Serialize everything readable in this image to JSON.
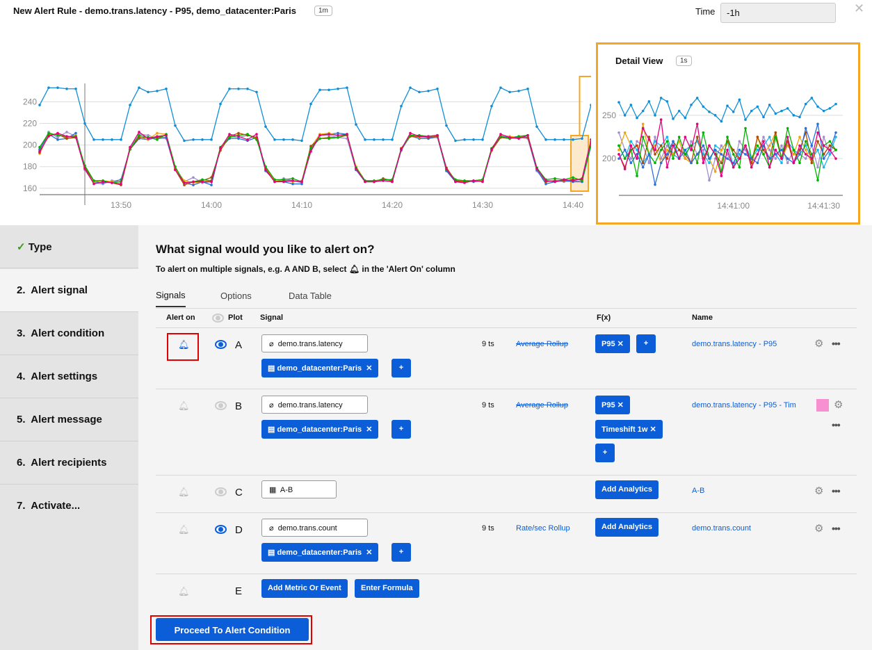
{
  "header": {
    "title": "New Alert Rule - demo.trans.latency - P95, demo_datacenter:Paris",
    "resolution": "1m",
    "time_label": "Time",
    "time_value": "-1h",
    "close_icon": "close-icon"
  },
  "chart_data": [
    {
      "type": "line",
      "title": "",
      "ylim": [
        156,
        257
      ],
      "yticks": [
        "160",
        "180",
        "200",
        "220",
        "240"
      ],
      "xticks": [
        "13:50",
        "14:00",
        "14:10",
        "14:20",
        "14:30",
        "14:40"
      ],
      "grid": true,
      "cursor_time": "13:46",
      "highlight_range": [
        "14:39",
        "14:42"
      ],
      "x": [
        "13:41",
        "13:42",
        "13:43",
        "13:44",
        "13:45",
        "13:46",
        "13:47",
        "13:48",
        "13:49",
        "13:50",
        "13:51",
        "13:52",
        "13:53",
        "13:54",
        "13:55",
        "13:56",
        "13:57",
        "13:58",
        "13:59",
        "14:00",
        "14:01",
        "14:02",
        "14:03",
        "14:04",
        "14:05",
        "14:06",
        "14:07",
        "14:08",
        "14:09",
        "14:10",
        "14:11",
        "14:12",
        "14:13",
        "14:14",
        "14:15",
        "14:16",
        "14:17",
        "14:18",
        "14:19",
        "14:20",
        "14:21",
        "14:22",
        "14:23",
        "14:24",
        "14:25",
        "14:26",
        "14:27",
        "14:28",
        "14:29",
        "14:30",
        "14:31",
        "14:32",
        "14:33",
        "14:34",
        "14:35",
        "14:36",
        "14:37",
        "14:38",
        "14:39",
        "14:40",
        "14:41",
        "14:42"
      ],
      "series": [
        {
          "color": "#0d8ed8",
          "values": [
            237,
            253,
            253,
            252,
            252,
            220,
            205,
            205,
            205,
            205,
            237,
            253,
            249,
            250,
            252,
            218,
            204,
            205,
            205,
            205,
            238,
            252,
            252,
            252,
            249,
            217,
            205,
            205,
            205,
            204,
            238,
            251,
            251,
            252,
            253,
            219,
            205,
            205,
            205,
            205,
            236,
            253,
            249,
            250,
            252,
            218,
            204,
            205,
            205,
            205,
            236,
            253,
            249,
            250,
            252,
            217,
            205,
            205,
            205,
            205,
            206,
            237
          ]
        },
        {
          "color": "#a18fcf",
          "values": [
            195,
            212,
            207,
            212,
            208,
            177,
            165,
            164,
            167,
            166,
            197,
            210,
            209,
            206,
            206,
            177,
            166,
            170,
            165,
            166,
            196,
            208,
            207,
            209,
            207,
            177,
            166,
            169,
            167,
            165,
            196,
            209,
            209,
            207,
            206,
            177,
            167,
            167,
            167,
            167,
            196,
            208,
            206,
            206,
            207,
            177,
            166,
            166,
            167,
            167,
            195,
            207,
            206,
            207,
            206,
            176,
            166,
            167,
            166,
            167,
            166,
            199
          ]
        },
        {
          "color": "#2a6fdb",
          "values": [
            196,
            210,
            205,
            206,
            211,
            179,
            166,
            165,
            166,
            168,
            196,
            206,
            205,
            207,
            207,
            178,
            165,
            163,
            166,
            163,
            197,
            206,
            206,
            204,
            207,
            176,
            167,
            166,
            164,
            164,
            196,
            210,
            210,
            211,
            210,
            177,
            166,
            166,
            167,
            166,
            195,
            209,
            206,
            206,
            208,
            176,
            166,
            167,
            166,
            167,
            196,
            208,
            207,
            208,
            207,
            177,
            164,
            166,
            167,
            166,
            166,
            200
          ]
        },
        {
          "color": "#f0a30a",
          "values": [
            192,
            210,
            210,
            207,
            209,
            180,
            166,
            167,
            166,
            166,
            196,
            208,
            205,
            211,
            210,
            178,
            167,
            165,
            166,
            167,
            196,
            208,
            209,
            210,
            206,
            179,
            167,
            167,
            166,
            167,
            198,
            210,
            211,
            209,
            209,
            180,
            167,
            167,
            167,
            167,
            196,
            209,
            207,
            208,
            209,
            178,
            167,
            167,
            167,
            167,
            197,
            209,
            208,
            207,
            209,
            179,
            167,
            167,
            167,
            168,
            168,
            202
          ]
        },
        {
          "color": "#b04a00",
          "values": [
            193,
            209,
            210,
            206,
            207,
            179,
            167,
            167,
            165,
            163,
            196,
            207,
            207,
            207,
            209,
            177,
            163,
            166,
            167,
            170,
            195,
            208,
            211,
            209,
            207,
            178,
            166,
            167,
            167,
            166,
            199,
            206,
            207,
            207,
            209,
            179,
            166,
            166,
            169,
            167,
            197,
            208,
            208,
            207,
            208,
            179,
            167,
            166,
            167,
            168,
            195,
            207,
            206,
            207,
            207,
            179,
            166,
            167,
            167,
            168,
            168,
            203
          ]
        },
        {
          "color": "#00b200",
          "values": [
            198,
            211,
            209,
            208,
            208,
            181,
            167,
            167,
            165,
            166,
            196,
            209,
            207,
            205,
            210,
            180,
            165,
            166,
            168,
            167,
            198,
            207,
            209,
            210,
            205,
            180,
            168,
            168,
            169,
            166,
            197,
            206,
            206,
            207,
            210,
            179,
            167,
            167,
            168,
            168,
            196,
            209,
            209,
            208,
            209,
            177,
            168,
            167,
            167,
            168,
            197,
            208,
            206,
            208,
            209,
            179,
            168,
            169,
            168,
            170,
            167,
            201
          ]
        },
        {
          "color": "#e5007e",
          "values": [
            194,
            208,
            211,
            208,
            207,
            178,
            164,
            166,
            165,
            164,
            198,
            212,
            206,
            208,
            209,
            177,
            165,
            166,
            166,
            166,
            197,
            210,
            208,
            205,
            210,
            177,
            166,
            166,
            167,
            166,
            194,
            209,
            210,
            209,
            210,
            178,
            166,
            166,
            167,
            166,
            196,
            211,
            208,
            208,
            209,
            178,
            166,
            165,
            167,
            166,
            196,
            210,
            207,
            206,
            209,
            178,
            167,
            166,
            168,
            167,
            169,
            205
          ]
        }
      ]
    },
    {
      "type": "line",
      "title": "Detail View",
      "resolution": "1s",
      "ylim": [
        160,
        286
      ],
      "yticks": [
        "200",
        "250"
      ],
      "xticks": [
        "14:41:00",
        "14:41:30"
      ],
      "grid": true,
      "x": [
        "14:40:22",
        "14:40:24",
        "14:40:26",
        "14:40:28",
        "14:40:30",
        "14:40:32",
        "14:40:34",
        "14:40:36",
        "14:40:38",
        "14:40:40",
        "14:40:42",
        "14:40:44",
        "14:40:46",
        "14:40:48",
        "14:40:50",
        "14:40:52",
        "14:40:54",
        "14:40:56",
        "14:40:58",
        "14:41:00",
        "14:41:02",
        "14:41:04",
        "14:41:06",
        "14:41:08",
        "14:41:10",
        "14:41:12",
        "14:41:14",
        "14:41:16",
        "14:41:18",
        "14:41:20",
        "14:41:22",
        "14:41:24",
        "14:41:26",
        "14:41:28",
        "14:41:30",
        "14:41:32",
        "14:41:34"
      ],
      "series": [
        {
          "color": "#0d8ed8",
          "values": [
            265,
            250,
            262,
            247,
            255,
            266,
            250,
            270,
            266,
            246,
            255,
            247,
            262,
            270,
            260,
            254,
            250,
            243,
            261,
            254,
            268,
            245,
            255,
            260,
            248,
            262,
            252,
            255,
            258,
            250,
            248,
            263,
            270,
            260,
            255,
            258,
            263
          ]
        },
        {
          "color": "#a18fcf",
          "values": [
            230,
            210,
            200,
            220,
            215,
            195,
            225,
            200,
            215,
            205,
            210,
            200,
            220,
            205,
            210,
            175,
            200,
            215,
            205,
            190,
            220,
            210,
            195,
            205,
            225,
            210,
            200,
            215,
            195,
            210,
            205,
            200,
            215,
            190,
            225,
            205,
            210
          ]
        },
        {
          "color": "#1ab4f0",
          "values": [
            215,
            200,
            220,
            210,
            195,
            205,
            220,
            215,
            225,
            205,
            200,
            210,
            215,
            220,
            205,
            195,
            215,
            210,
            220,
            190,
            205,
            215,
            200,
            210,
            215,
            225,
            205,
            195,
            220,
            210,
            205,
            215,
            200,
            210,
            190,
            205,
            225
          ]
        },
        {
          "color": "#f0a30a",
          "values": [
            210,
            230,
            215,
            200,
            240,
            205,
            215,
            195,
            210,
            205,
            220,
            200,
            195,
            205,
            215,
            200,
            185,
            210,
            220,
            205,
            200,
            215,
            190,
            225,
            205,
            215,
            230,
            200,
            215,
            205,
            225,
            210,
            195,
            220,
            205,
            215,
            210
          ]
        },
        {
          "color": "#b04a00",
          "values": [
            205,
            190,
            210,
            215,
            195,
            225,
            205,
            215,
            200,
            220,
            210,
            205,
            195,
            225,
            200,
            215,
            205,
            195,
            220,
            210,
            200,
            215,
            195,
            225,
            210,
            200,
            230,
            200,
            220,
            195,
            210,
            230,
            195,
            220,
            205,
            215,
            210
          ]
        },
        {
          "color": "#00b200",
          "values": [
            215,
            200,
            210,
            180,
            225,
            205,
            195,
            210,
            220,
            200,
            225,
            205,
            215,
            195,
            230,
            200,
            210,
            185,
            225,
            205,
            190,
            235,
            200,
            215,
            205,
            190,
            225,
            200,
            235,
            210,
            195,
            220,
            205,
            175,
            215,
            220,
            210
          ]
        },
        {
          "color": "#2a6fdb",
          "values": [
            200,
            210,
            195,
            205,
            190,
            205,
            170,
            195,
            205,
            220,
            200,
            210,
            195,
            205,
            215,
            200,
            210,
            205,
            200,
            195,
            210,
            205,
            200,
            195,
            215,
            200,
            205,
            210,
            200,
            195,
            205,
            235,
            215,
            240,
            200,
            210,
            230
          ]
        },
        {
          "color": "#e5007e",
          "values": [
            205,
            188,
            215,
            200,
            235,
            222,
            210,
            245,
            190,
            215,
            200,
            225,
            210,
            240,
            195,
            215,
            205,
            180,
            210,
            190,
            200,
            215,
            190,
            205,
            220,
            190,
            210,
            200,
            225,
            195,
            215,
            205,
            200,
            230,
            215,
            210,
            200
          ]
        }
      ]
    }
  ],
  "sidebar": {
    "items": [
      {
        "label": "Type",
        "icon": "checkmark-icon",
        "done": true
      },
      {
        "label": "2.  Alert signal"
      },
      {
        "label": "3.  Alert condition"
      },
      {
        "label": "4.  Alert settings"
      },
      {
        "label": "5.  Alert message"
      },
      {
        "label": "6.  Alert recipients"
      },
      {
        "label": "7.  Activate..."
      }
    ]
  },
  "main": {
    "heading": "What signal would you like to alert on?",
    "sub_pre": "To alert on multiple signals, e.g. A AND B, select",
    "sub_post": "in the 'Alert On' column",
    "tabs": [
      {
        "label": "Signals",
        "active": true
      },
      {
        "label": "Options"
      },
      {
        "label": "Data Table"
      }
    ],
    "columns": {
      "alert_on": "Alert on",
      "plot": "Plot",
      "signal": "Signal",
      "fx": "F(x)",
      "name": "Name"
    },
    "rows": [
      {
        "letter": "A",
        "alert_on": true,
        "visible": true,
        "signal": "demo.trans.latency",
        "filter": "demo_datacenter:Paris",
        "ts": "9 ts",
        "rollup": "Average Rollup",
        "fx": [
          "P95"
        ],
        "name": "demo.trans.latency - P95"
      },
      {
        "letter": "B",
        "alert_on": false,
        "visible": false,
        "signal": "demo.trans.latency",
        "filter": "demo_datacenter:Paris",
        "ts": "9 ts",
        "rollup": "Average Rollup",
        "fx": [
          "P95",
          "Timeshift 1w"
        ],
        "name": "demo.trans.latency - P95 - Tim",
        "color": "#f78fd0"
      },
      {
        "letter": "C",
        "alert_on": false,
        "visible": false,
        "signal": "A-B",
        "fx_button": "Add Analytics",
        "name": "A-B"
      },
      {
        "letter": "D",
        "alert_on": false,
        "visible": true,
        "signal": "demo.trans.count",
        "filter": "demo_datacenter:Paris",
        "ts": "9 ts",
        "rollup": "Rate/sec Rollup",
        "fx_button": "Add Analytics",
        "name": "demo.trans.count"
      },
      {
        "letter": "E",
        "add_metric": "Add Metric Or Event",
        "enter_formula": "Enter Formula"
      }
    ],
    "plus": "+",
    "remove": "✕",
    "proceed": "Proceed To Alert Condition"
  }
}
